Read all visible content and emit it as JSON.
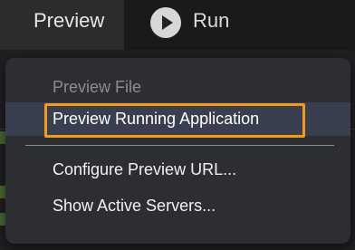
{
  "toolbar": {
    "preview_tab_label": "Preview",
    "run_label": "Run",
    "run_icon": "play-icon"
  },
  "menu": {
    "items": [
      {
        "label": "Preview File",
        "enabled": false
      },
      {
        "label": "Preview Running Application",
        "enabled": true,
        "highlighted": true
      },
      {
        "label": "Configure Preview URL...",
        "enabled": true
      },
      {
        "label": "Show Active Servers...",
        "enabled": true
      }
    ]
  },
  "colors": {
    "highlight_border": "#f39a1e",
    "menu_background": "#2d2e31",
    "hover_background": "#3a3f4f",
    "separator": "#7a8fa3"
  }
}
